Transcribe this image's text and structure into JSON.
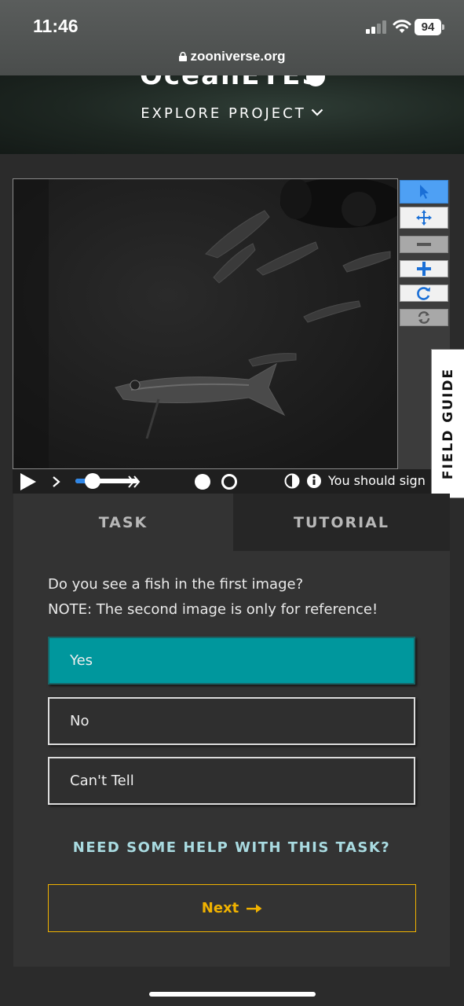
{
  "status_bar": {
    "time": "11:46",
    "battery": "94",
    "url": "zooniverse.org"
  },
  "hero": {
    "title_partial": "OceanEYES",
    "explore": "EXPLORE PROJECT"
  },
  "viewer": {
    "tools": [
      "pointer-icon",
      "move-icon",
      "zoom-out-icon",
      "zoom-in-icon",
      "rotate-icon",
      "reset-icon"
    ],
    "field_guide": "FIELD GUIDE",
    "signin_text": "You should sign",
    "speed_fraction": 0.28
  },
  "tabs": {
    "task": "TASK",
    "tutorial": "TUTORIAL"
  },
  "task": {
    "question_line1": "Do you see a fish in the first image?",
    "question_line2": "NOTE: The second image is only for reference!",
    "answers": [
      {
        "label": "Yes",
        "selected": true
      },
      {
        "label": "No",
        "selected": false
      },
      {
        "label": "Can't Tell",
        "selected": false
      }
    ],
    "help": "NEED SOME HELP WITH THIS TASK?",
    "next": "Next"
  },
  "colors": {
    "accent_teal": "#00979d",
    "next_gold": "#f0b200",
    "help_link": "#a9dbe1",
    "tool_active": "#4ea0f4"
  }
}
